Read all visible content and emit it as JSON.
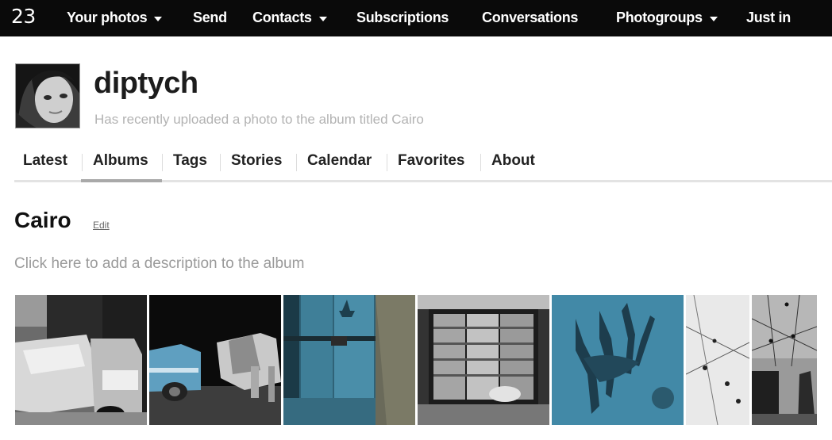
{
  "topbar": {
    "logo": "23",
    "nav": [
      {
        "label": "Your photos",
        "has_dropdown": true
      },
      {
        "label": "Send",
        "has_dropdown": false
      },
      {
        "label": "Contacts",
        "has_dropdown": true
      },
      {
        "label": "Subscriptions",
        "has_dropdown": false
      },
      {
        "label": "Conversations",
        "has_dropdown": false
      },
      {
        "label": "Photogroups",
        "has_dropdown": true
      },
      {
        "label": "Just in",
        "has_dropdown": false
      }
    ]
  },
  "profile": {
    "username": "diptych",
    "status": "Has recently uploaded a photo to the album titled Cairo"
  },
  "tabs": {
    "items": [
      "Latest",
      "Albums",
      "Tags",
      "Stories",
      "Calendar",
      "Favorites",
      "About"
    ],
    "active": "Albums"
  },
  "album": {
    "title": "Cairo",
    "edit_label": "Edit",
    "description_prompt": "Click here to add a description to the album"
  },
  "colors": {
    "topbar_bg": "#0a0a0a",
    "muted_text": "#b3b3b3",
    "teal_photo": "#3f7f98"
  }
}
